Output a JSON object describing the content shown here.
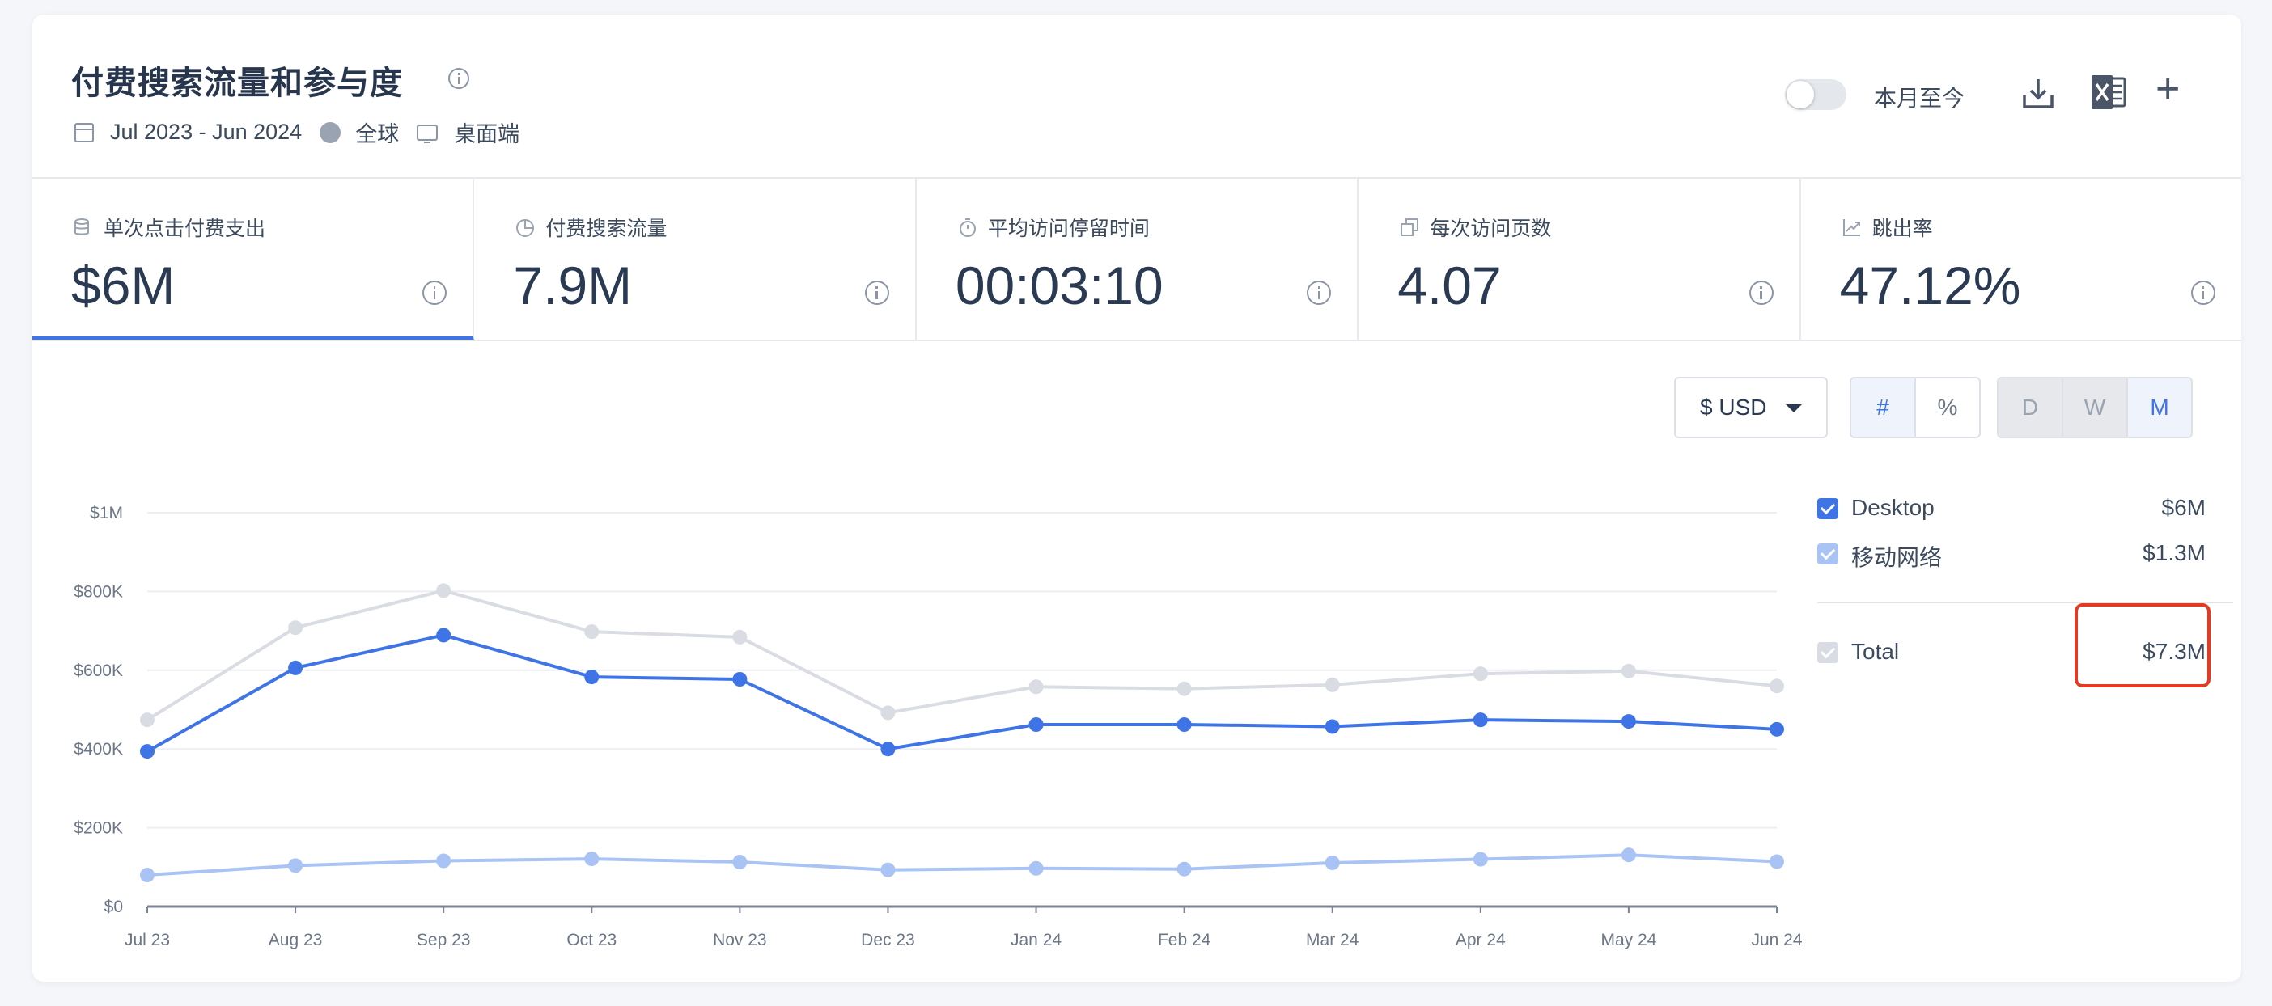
{
  "header": {
    "title": "付费搜索流量和参与度",
    "date_range": "Jul 2023 - Jun 2024",
    "region": "全球",
    "device": "桌面端",
    "toggle_label": "本月至今"
  },
  "metrics": [
    {
      "label": "单次点击付费支出",
      "value": "$6M",
      "icon": "coins-icon",
      "active": true
    },
    {
      "label": "付费搜索流量",
      "value": "7.9M",
      "icon": "pie-chart-icon"
    },
    {
      "label": "平均访问停留时间",
      "value": "00:03:10",
      "icon": "stopwatch-icon"
    },
    {
      "label": "每次访问页数",
      "value": "4.07",
      "icon": "pages-icon"
    },
    {
      "label": "跳出率",
      "value": "47.12%",
      "icon": "trend-icon"
    }
  ],
  "controls": {
    "currency": "$ USD",
    "value_modes": [
      "#",
      "%"
    ],
    "value_mode_selected": "#",
    "granularity": [
      "D",
      "W",
      "M"
    ],
    "granularity_selected": "M"
  },
  "legend": {
    "desktop": {
      "label": "Desktop",
      "value": "$6M"
    },
    "mobile": {
      "label": "移动网络",
      "value": "$1.3M"
    },
    "total": {
      "label": "Total",
      "value": "$7.3M"
    }
  },
  "colors": {
    "desktop": "#3f74e6",
    "mobile": "#a9c3f5",
    "total": "#d9dce2",
    "highlight": "#e33a24"
  },
  "chart_data": {
    "type": "line",
    "categories": [
      "Jul 23",
      "Aug 23",
      "Sep 23",
      "Oct 23",
      "Nov 23",
      "Dec 23",
      "Jan 24",
      "Feb 24",
      "Mar 24",
      "Apr 24",
      "May 24",
      "Jun 24"
    ],
    "y_ticks": [
      "$0",
      "$200K",
      "$400K",
      "$600K",
      "$800K",
      "$1M"
    ],
    "ylim": [
      0,
      1000000
    ],
    "series": [
      {
        "name": "Total",
        "values": [
          474000,
          708000,
          802000,
          698000,
          684000,
          492000,
          558000,
          553000,
          563000,
          591000,
          598000,
          560000
        ]
      },
      {
        "name": "Desktop",
        "values": [
          394000,
          606000,
          689000,
          583000,
          577000,
          400000,
          462000,
          462000,
          457000,
          474000,
          470000,
          450000
        ]
      },
      {
        "name": "移动网络",
        "values": [
          80000,
          104000,
          116000,
          121000,
          113000,
          93000,
          97000,
          95000,
          111000,
          120000,
          131000,
          114000
        ]
      }
    ]
  }
}
